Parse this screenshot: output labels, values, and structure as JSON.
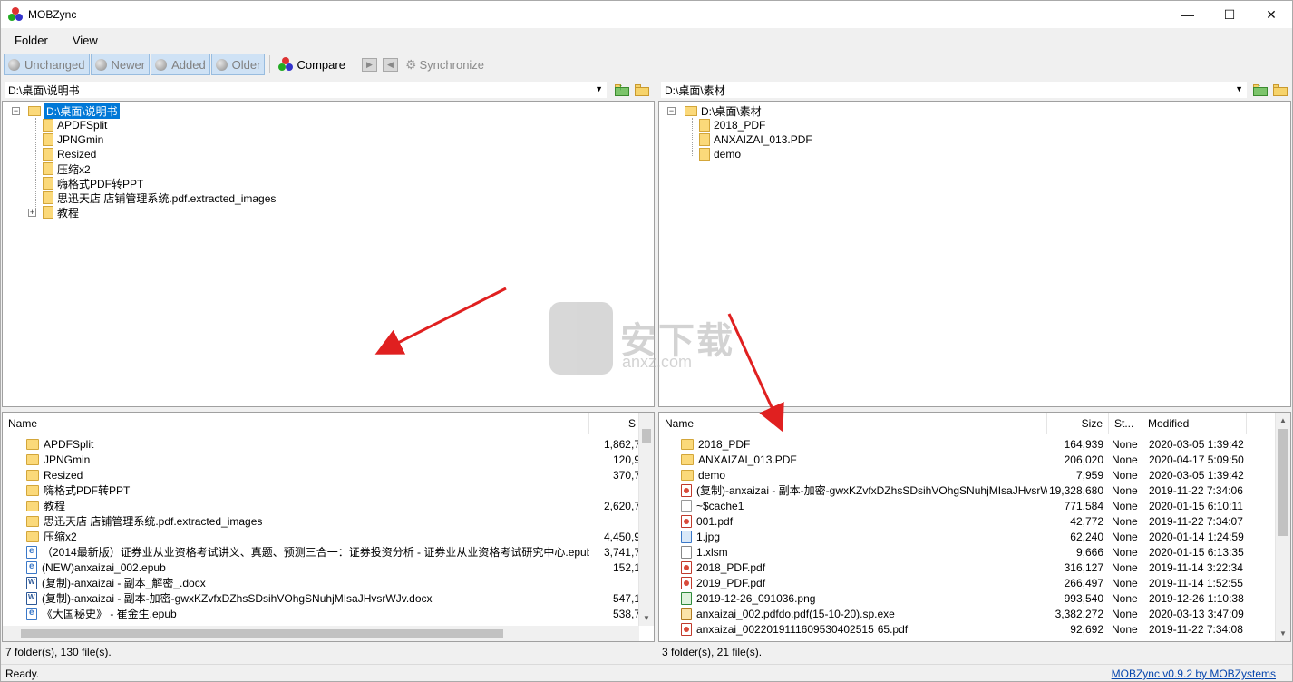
{
  "window": {
    "title": "MOBZync",
    "minimize": "—",
    "maximize": "☐",
    "close": "✕"
  },
  "menu": {
    "folder": "Folder",
    "view": "View"
  },
  "toolbar": {
    "unchanged": "Unchanged",
    "newer": "Newer",
    "added": "Added",
    "older": "Older",
    "compare": "Compare",
    "synchronize": "Synchronize"
  },
  "left": {
    "path": "D:\\桌面\\说明书",
    "tree_root": "D:\\桌面\\说明书",
    "tree": [
      "APDFSplit",
      "JPNGmin",
      "Resized",
      "压缩x2",
      "嗨格式PDF转PPT",
      "思迅天店 店铺管理系统.pdf.extracted_images",
      "教程"
    ],
    "columns": {
      "name": "Name",
      "size": "S"
    },
    "rows": [
      {
        "icon": "folder",
        "name": "APDFSplit",
        "size": "1,862,7"
      },
      {
        "icon": "folder",
        "name": "JPNGmin",
        "size": "120,9"
      },
      {
        "icon": "folder",
        "name": "Resized",
        "size": "370,7"
      },
      {
        "icon": "folder",
        "name": "嗨格式PDF转PPT",
        "size": ""
      },
      {
        "icon": "folder",
        "name": "教程",
        "size": "2,620,7"
      },
      {
        "icon": "folder",
        "name": "思迅天店 店铺管理系统.pdf.extracted_images",
        "size": ""
      },
      {
        "icon": "folder",
        "name": "压缩x2",
        "size": "4,450,9"
      },
      {
        "icon": "epub",
        "name": "（2014最新版）证券业从业资格考试讲义、真题、预测三合一：证券投资分析 - 证券业从业资格考试研究中心.epub",
        "size": "3,741,7"
      },
      {
        "icon": "epub",
        "name": "(NEW)anxaizai_002.epub",
        "size": "152,1"
      },
      {
        "icon": "doc",
        "name": "(复制)-anxaizai - 副本_解密_.docx",
        "size": ""
      },
      {
        "icon": "doc",
        "name": "(复制)-anxaizai - 副本-加密-gwxKZvfxDZhsSDsihVOhgSNuhjMIsaJHvsrWJv.docx",
        "size": "547,1"
      },
      {
        "icon": "epub",
        "name": "《大国秘史》 - 崔金生.epub",
        "size": "538,7"
      }
    ],
    "status": "7 folder(s), 130 file(s)."
  },
  "right": {
    "path": "D:\\桌面\\素材",
    "tree_root": "D:\\桌面\\素材",
    "tree": [
      "2018_PDF",
      "ANXAIZAI_013.PDF",
      "demo"
    ],
    "columns": {
      "name": "Name",
      "size": "Size",
      "status": "St...",
      "modified": "Modified"
    },
    "rows": [
      {
        "icon": "folder",
        "name": "2018_PDF",
        "size": "164,939",
        "status": "None",
        "modified": "2020-03-05 1:39:42"
      },
      {
        "icon": "folder",
        "name": "ANXAIZAI_013.PDF",
        "size": "206,020",
        "status": "None",
        "modified": "2020-04-17 5:09:50"
      },
      {
        "icon": "folder",
        "name": "demo",
        "size": "7,959",
        "status": "None",
        "modified": "2020-03-05 1:39:42"
      },
      {
        "icon": "pdf",
        "name": "(复制)-anxaizai - 副本-加密-gwxKZvfxDZhsSDsihVOhgSNuhjMIsaJHvsrWJv.pdf",
        "size": "19,328,680",
        "status": "None",
        "modified": "2019-11-22 7:34:06"
      },
      {
        "icon": "gen",
        "name": "~$cache1",
        "size": "771,584",
        "status": "None",
        "modified": "2020-01-15 6:10:11"
      },
      {
        "icon": "pdf",
        "name": "001.pdf",
        "size": "42,772",
        "status": "None",
        "modified": "2019-11-22 7:34:07"
      },
      {
        "icon": "img",
        "name": "1.jpg",
        "size": "62,240",
        "status": "None",
        "modified": "2020-01-14 1:24:59"
      },
      {
        "icon": "xls",
        "name": "1.xlsm",
        "size": "9,666",
        "status": "None",
        "modified": "2020-01-15 6:13:35"
      },
      {
        "icon": "pdf",
        "name": "2018_PDF.pdf",
        "size": "316,127",
        "status": "None",
        "modified": "2019-11-14 3:22:34"
      },
      {
        "icon": "pdf",
        "name": "2019_PDF.pdf",
        "size": "266,497",
        "status": "None",
        "modified": "2019-11-14 1:52:55"
      },
      {
        "icon": "png",
        "name": "2019-12-26_091036.png",
        "size": "993,540",
        "status": "None",
        "modified": "2019-12-26 1:10:38"
      },
      {
        "icon": "exe",
        "name": "anxaizai_002.pdfdo.pdf(15-10-20).sp.exe",
        "size": "3,382,272",
        "status": "None",
        "modified": "2020-03-13 3:47:09"
      },
      {
        "icon": "pdf",
        "name": "anxaizai_0022019111609530402515 65.pdf",
        "size": "92,692",
        "status": "None",
        "modified": "2019-11-22 7:34:08"
      }
    ],
    "status": "3 folder(s), 21 file(s)."
  },
  "statusbar": {
    "text": "Ready.",
    "link": "MOBZync v0.9.2 by MOBZystems"
  },
  "watermark": {
    "main": "安下载",
    "sub": "anxz.com"
  },
  "colors": {
    "accent": "#0078d7",
    "arrow": "#e02020",
    "link": "#0645ad"
  }
}
